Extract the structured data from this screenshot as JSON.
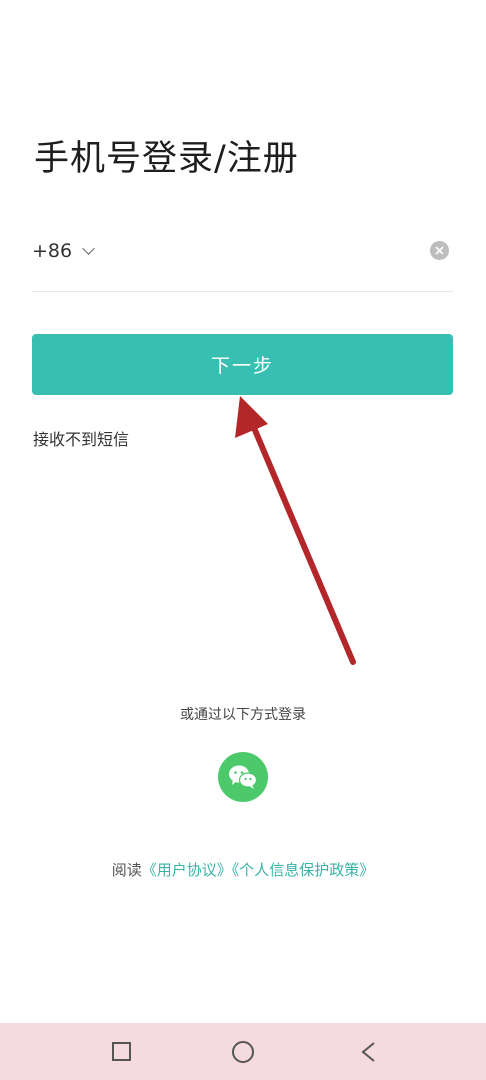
{
  "header": {
    "title": "手机号登录/注册"
  },
  "phone": {
    "country_code": "+86",
    "value": ""
  },
  "actions": {
    "next_label": "下一步",
    "no_sms_label": "接收不到短信"
  },
  "alt_login": {
    "label": "或通过以下方式登录",
    "icon": "wechat-icon"
  },
  "agreement": {
    "prefix": "阅读",
    "user_agreement": "《用户协议》",
    "privacy_policy": "《个人信息保护政策》"
  },
  "colors": {
    "accent": "#38bfb2",
    "wechat": "#4cc96b",
    "annotation_arrow": "#b3262a"
  }
}
